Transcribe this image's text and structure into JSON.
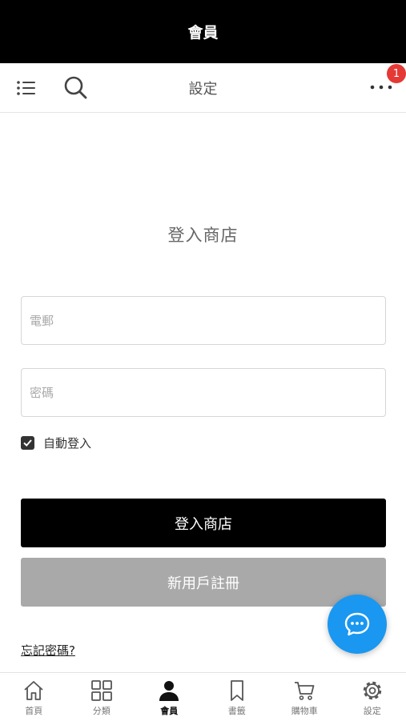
{
  "header": {
    "title": "會員"
  },
  "toolbar": {
    "title": "設定",
    "notification_count": "1",
    "icons": [
      "menu-list-icon",
      "search-icon",
      "more-icon"
    ]
  },
  "login": {
    "heading": "登入商店",
    "email_placeholder": "電郵",
    "password_placeholder": "密碼",
    "remember_label": "自動登入",
    "remember_checked": true,
    "login_button": "登入商店",
    "register_button": "新用戶註冊",
    "forgot_link": "忘記密碼?"
  },
  "tabs": [
    {
      "label": "首頁",
      "icon": "home-icon"
    },
    {
      "label": "分類",
      "icon": "grid-icon"
    },
    {
      "label": "會員",
      "icon": "user-icon",
      "active": true
    },
    {
      "label": "書籤",
      "icon": "bookmark-icon"
    },
    {
      "label": "購物車",
      "icon": "cart-icon"
    },
    {
      "label": "設定",
      "icon": "gear-icon"
    }
  ],
  "colors": {
    "header_bg": "#000000",
    "primary_button": "#000000",
    "secondary_button": "#a9a9a9",
    "chat_fab": "#1a97f0",
    "badge": "#e53935"
  }
}
